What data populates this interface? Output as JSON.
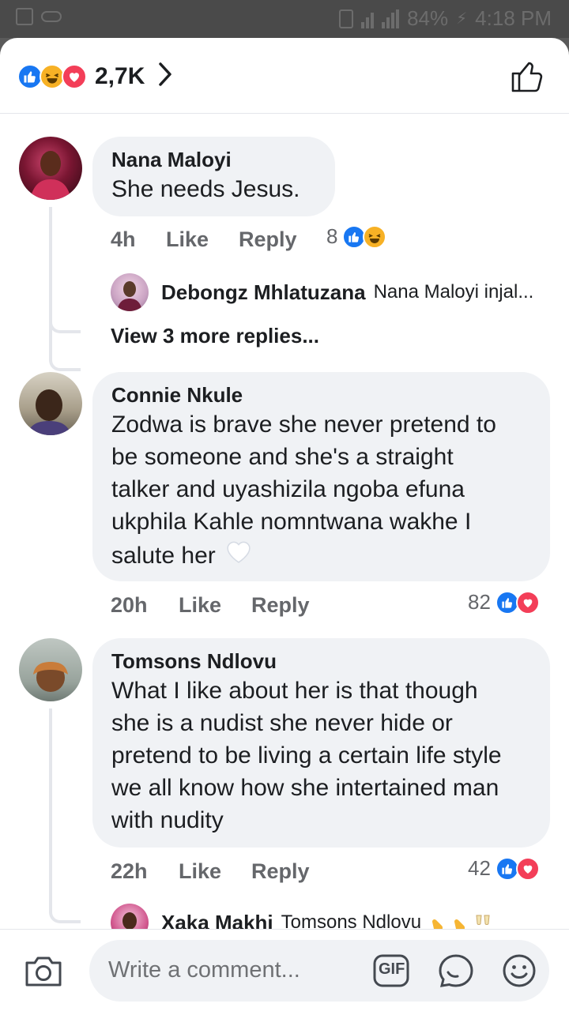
{
  "status_bar": {
    "battery": "84%",
    "time": "4:18 PM"
  },
  "header": {
    "reaction_count": "2,7K",
    "reactions": [
      "like",
      "haha",
      "love"
    ]
  },
  "comments": [
    {
      "author": "Nana Maloyi",
      "text": "She needs Jesus.",
      "time": "4h",
      "like_label": "Like",
      "reply_label": "Reply",
      "reaction_count": "8",
      "reactions": [
        "like",
        "haha"
      ],
      "reply_preview": {
        "author": "Debongz Mhlatuzana",
        "text": "Nana Maloyi injal..."
      },
      "view_more": "View 3 more replies..."
    },
    {
      "author": "Connie Nkule",
      "text_lines": [
        "Zodwa is brave she never pretend to",
        "be someone and she's a straight",
        "talker and uyashizila ngoba efuna",
        "ukphila Kahle nomntwana wakhe I",
        "salute her"
      ],
      "time": "20h",
      "like_label": "Like",
      "reply_label": "Reply",
      "reaction_count": "82",
      "reactions": [
        "like",
        "love"
      ]
    },
    {
      "author": "Tomsons Ndlovu",
      "text_lines": [
        "What I like about her is that though",
        "she is a nudist she never hide or",
        "pretend to be living a certain life style",
        "we all know how she intertained man",
        "with nudity"
      ],
      "time": "22h",
      "like_label": "Like",
      "reply_label": "Reply",
      "reaction_count": "42",
      "reactions": [
        "like",
        "love"
      ],
      "reply_preview": {
        "author": "Xaka Makhi",
        "text": "Tomsons Ndlovu"
      }
    }
  ],
  "composer": {
    "placeholder": "Write a comment...",
    "gif_label": "GIF"
  },
  "colors": {
    "like": "#1877f2",
    "haha": "#f7b125",
    "love": "#f33e58",
    "bubble": "#f0f2f5",
    "meta": "#65676b"
  }
}
